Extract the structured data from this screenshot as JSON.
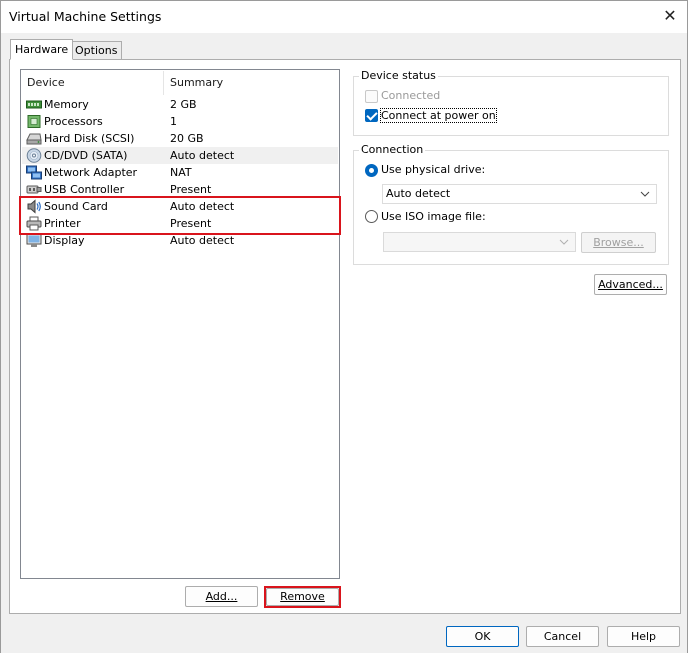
{
  "window": {
    "title": "Virtual Machine Settings",
    "close_glyph": "✕"
  },
  "tabs": [
    {
      "label": "Hardware",
      "active": true
    },
    {
      "label": "Options",
      "active": false
    }
  ],
  "device_list": {
    "columns": [
      "Device",
      "Summary"
    ],
    "rows": [
      {
        "device": "Memory",
        "summary": "2 GB",
        "icon": "memory-icon"
      },
      {
        "device": "Processors",
        "summary": "1",
        "icon": "processor-icon"
      },
      {
        "device": "Hard Disk (SCSI)",
        "summary": "20 GB",
        "icon": "hard-disk-icon"
      },
      {
        "device": "CD/DVD (SATA)",
        "summary": "Auto detect",
        "icon": "cd-dvd-icon",
        "selected": true
      },
      {
        "device": "Network Adapter",
        "summary": "NAT",
        "icon": "network-adapter-icon"
      },
      {
        "device": "USB Controller",
        "summary": "Present",
        "icon": "usb-icon"
      },
      {
        "device": "Sound Card",
        "summary": "Auto detect",
        "icon": "sound-card-icon"
      },
      {
        "device": "Printer",
        "summary": "Present",
        "icon": "printer-icon"
      },
      {
        "device": "Display",
        "summary": "Auto detect",
        "icon": "display-icon"
      }
    ]
  },
  "list_buttons": {
    "add": "Add...",
    "remove": "Remove"
  },
  "device_status": {
    "label": "Device status",
    "connected": {
      "label": "Connected",
      "checked": false,
      "enabled": false
    },
    "connect_at_power_on": {
      "label": "Connect at power on",
      "checked": true
    }
  },
  "connection": {
    "label": "Connection",
    "use_physical_drive": {
      "label": "Use physical drive:",
      "selected": true
    },
    "physical_drive_value": "Auto detect",
    "use_iso": {
      "label": "Use ISO image file:",
      "selected": false
    },
    "iso_value": "",
    "browse": "Browse..."
  },
  "advanced_button": "Advanced...",
  "footer": {
    "ok": "OK",
    "cancel": "Cancel",
    "help": "Help"
  },
  "colors": {
    "highlight_box": "#d9141c",
    "accent": "#0067c0"
  }
}
